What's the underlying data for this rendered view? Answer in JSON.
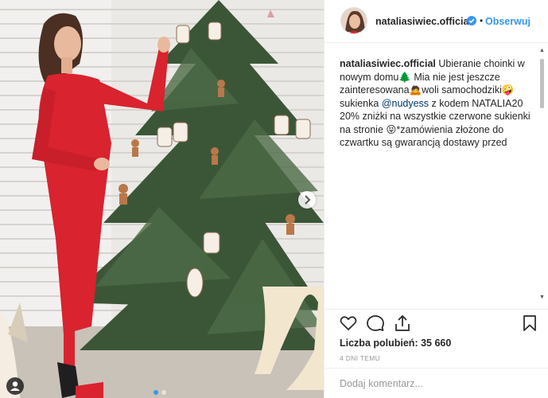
{
  "post": {
    "username": "nataliasiwiec.official",
    "separator": "•",
    "follow_label": "Obserwuj",
    "caption": {
      "user": "nataliasiwiec.official",
      "line1": " Ubieranie choinki w nowym domu🌲 Mia nie jest jeszcze zainteresowana🙇woli samochodziki🤪 sukienka ",
      "mention": "@nudyess",
      "line2": " z kodem NATALIA20 20% zniżki na wszystkie czerwone sukienki na stronie 😝*zamówienia złożone do czwartku są gwarancją dostawy przed świętami 💪🏼"
    },
    "likes_label": "Liczba polubień:",
    "likes_count": "35 660",
    "time_ago": "4 DNI TEMU",
    "comment_placeholder": "Dodaj komentarz..."
  },
  "carousel": {
    "slides": 2,
    "active_index": 0
  },
  "icons": [
    "verified-badge-icon",
    "heart-icon",
    "comment-icon",
    "share-icon",
    "bookmark-icon",
    "chevron-right-icon",
    "user-tag-icon"
  ],
  "colors": {
    "accent": "#3897f0",
    "text": "#262626",
    "muted": "#999999",
    "dress": "#d9232f",
    "tree": "#3e5a3c"
  }
}
